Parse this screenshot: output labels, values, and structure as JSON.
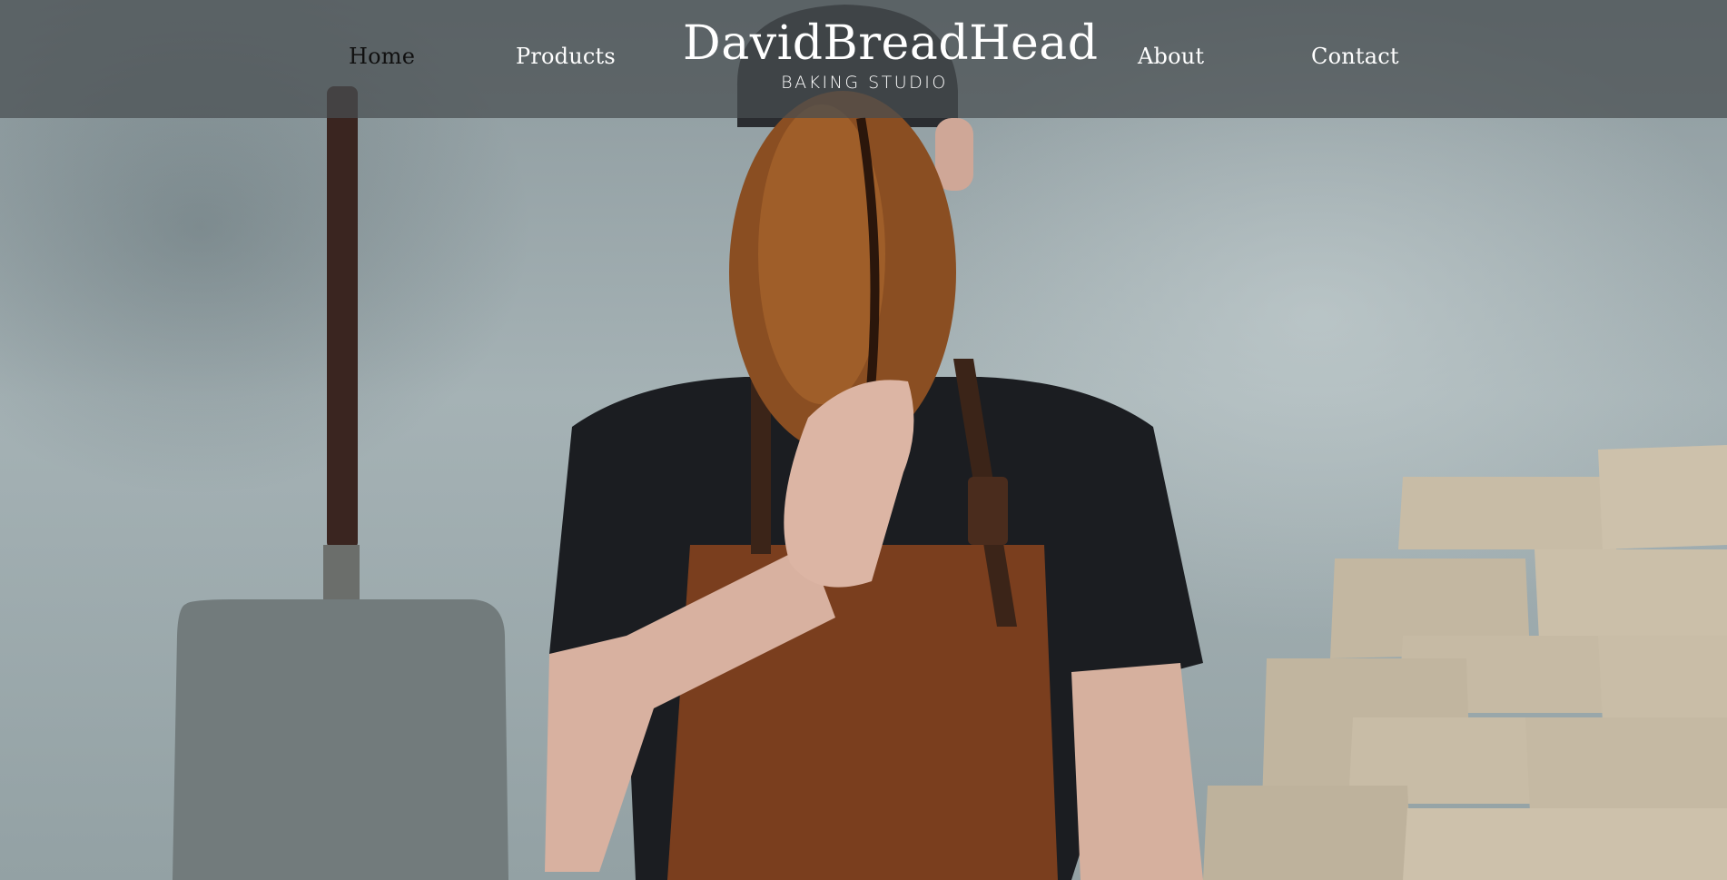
{
  "nav": {
    "items": [
      {
        "label": "Home",
        "active": true
      },
      {
        "label": "Products",
        "active": false
      },
      {
        "label": "About",
        "active": false
      },
      {
        "label": "Contact",
        "active": false
      }
    ]
  },
  "brand": {
    "title": "DavidBreadHead",
    "subtitle": "BAKING STUDIO"
  },
  "colors": {
    "nav_bg": "#484e50",
    "nav_text": "#ffffff",
    "nav_active_text": "#101010",
    "wall": "#9aa7aa",
    "apron": "#7a3e1e",
    "bread": "#8a4e22",
    "shirt": "#1b1d21",
    "bowls": "#c8bca6"
  },
  "hero": {
    "image_icon": "baker-holding-bread-photo-icon"
  }
}
